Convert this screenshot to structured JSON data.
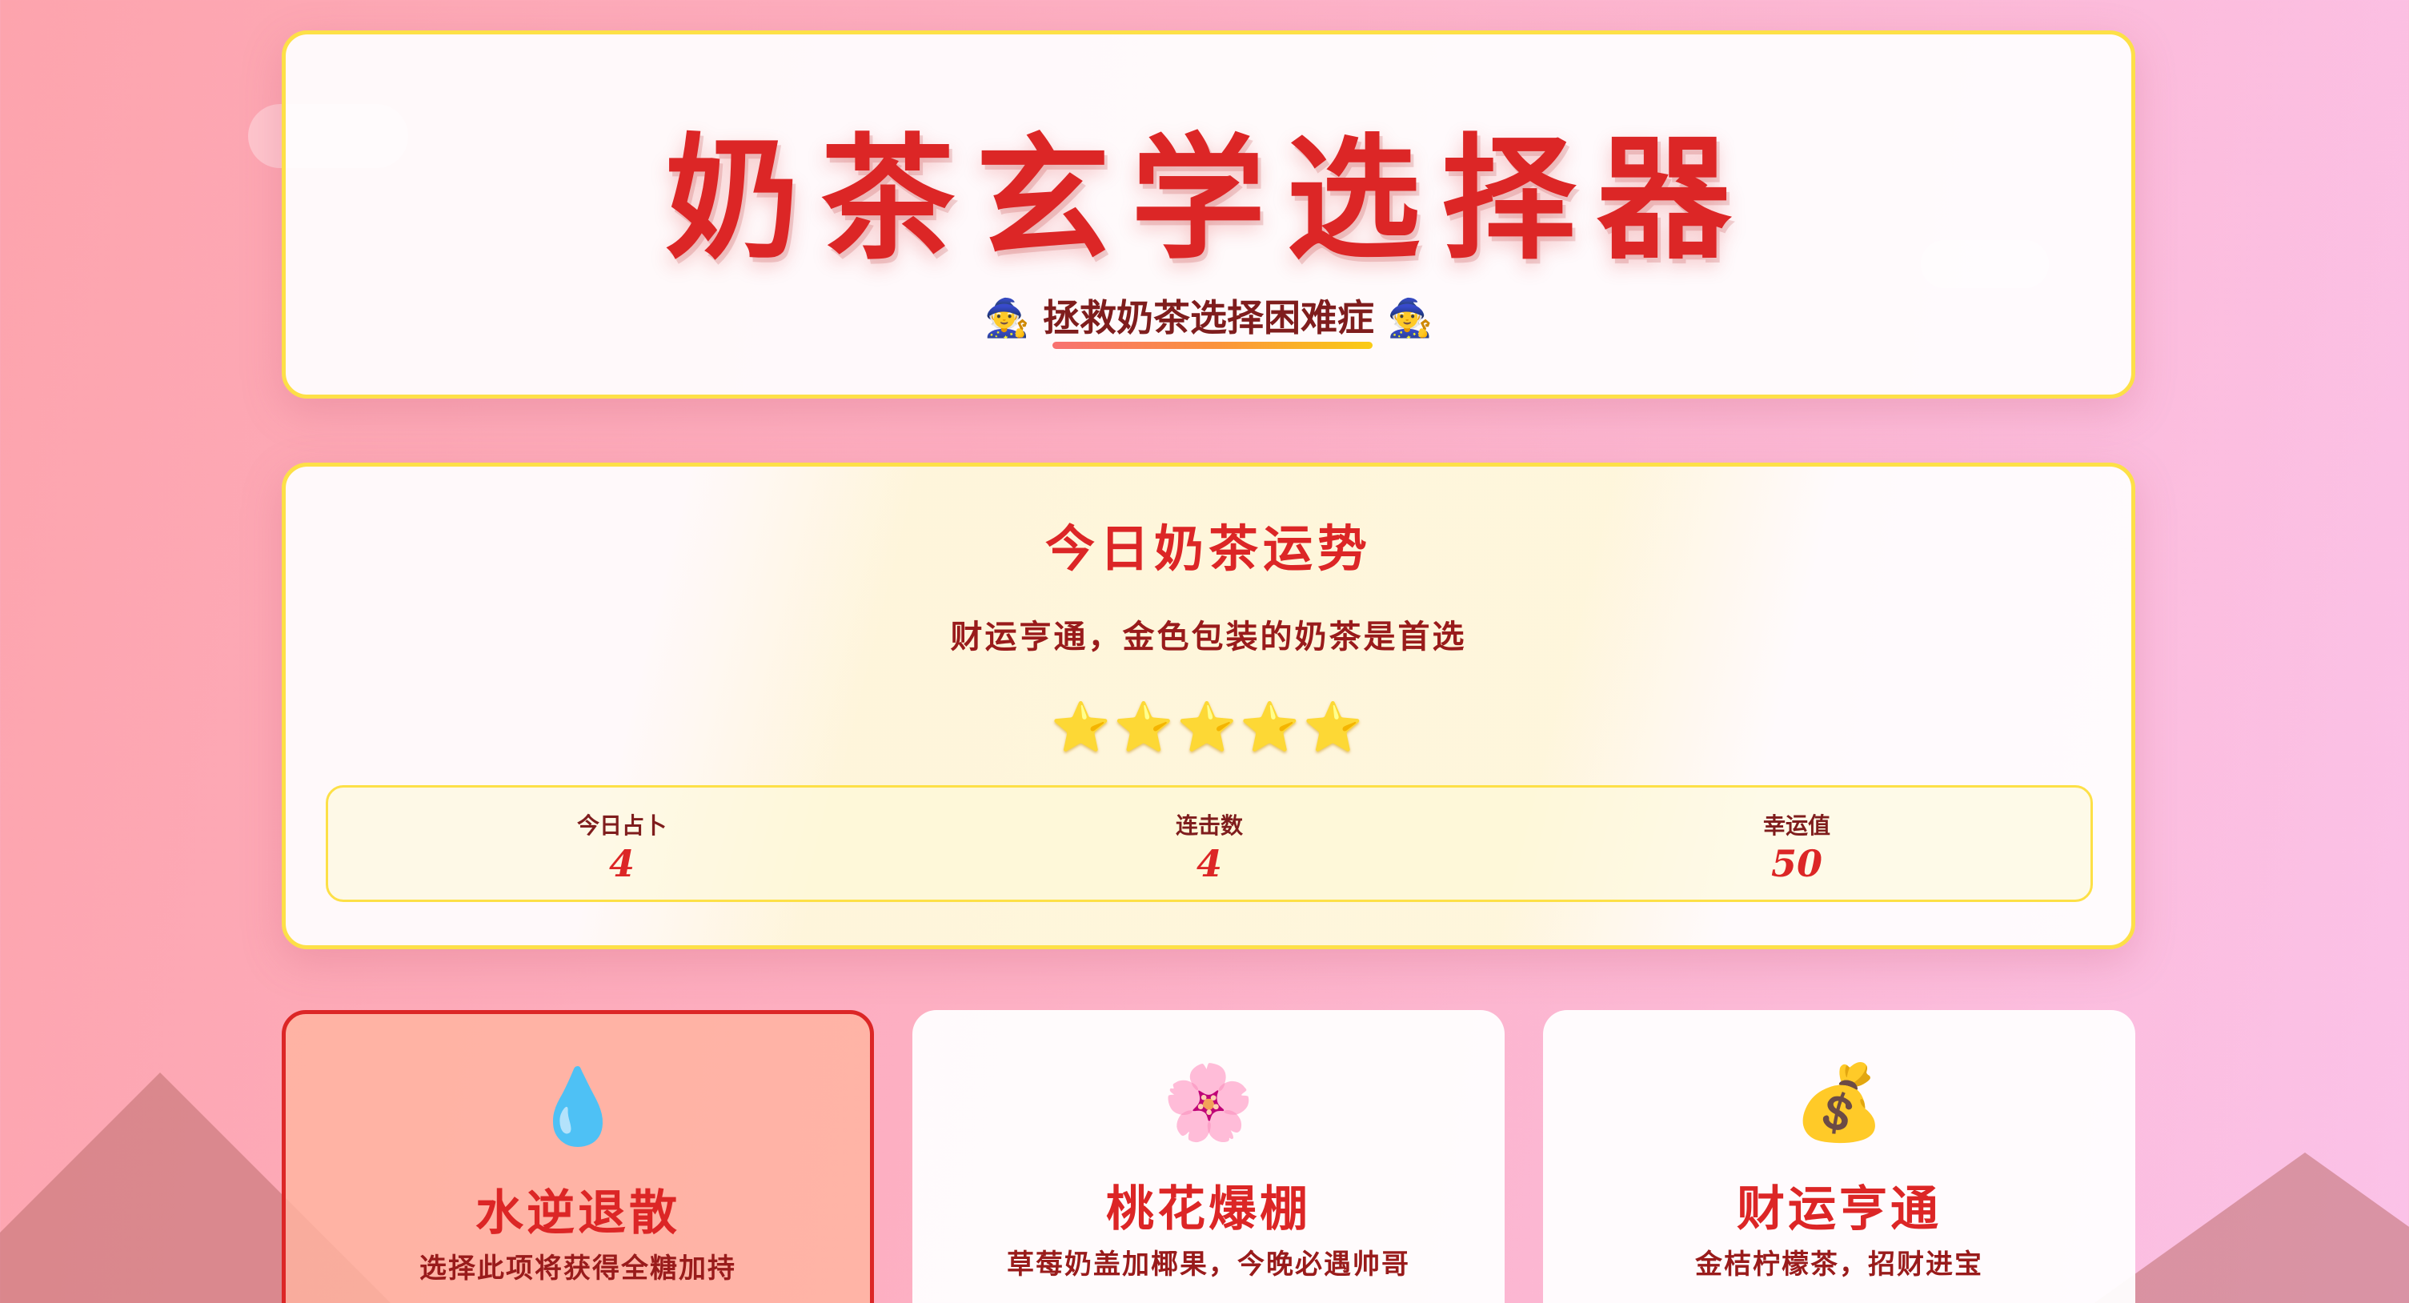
{
  "header": {
    "title": "奶茶玄学选择器",
    "subtitle": "🧙 拯救奶茶选择困难症 🧙"
  },
  "fortune": {
    "title": "今日奶茶运势",
    "text": "财运亨通，金色包装的奶茶是首选",
    "stars": "⭐⭐⭐⭐⭐",
    "stars_rating": 5,
    "stats": [
      {
        "label": "今日占卜",
        "value": "4"
      },
      {
        "label": "连击数",
        "value": "4"
      },
      {
        "label": "幸运值",
        "value": "50"
      }
    ]
  },
  "options": [
    {
      "icon": "💧",
      "icon_name": "water-drop-icon",
      "name": "水逆退散",
      "desc": "选择此项将获得全糖加持",
      "selected": true
    },
    {
      "icon": "🌸",
      "icon_name": "cherry-blossom-icon",
      "name": "桃花爆棚",
      "desc": "草莓奶盖加椰果，今晚必遇帅哥",
      "selected": false
    },
    {
      "icon": "💰",
      "icon_name": "money-bag-icon",
      "name": "财运亨通",
      "desc": "金桔柠檬茶，招财进宝",
      "selected": false
    }
  ],
  "colors": {
    "accent": "#dc2626",
    "border_gold": "#fde047",
    "text_dark_red": "#991b1b"
  }
}
